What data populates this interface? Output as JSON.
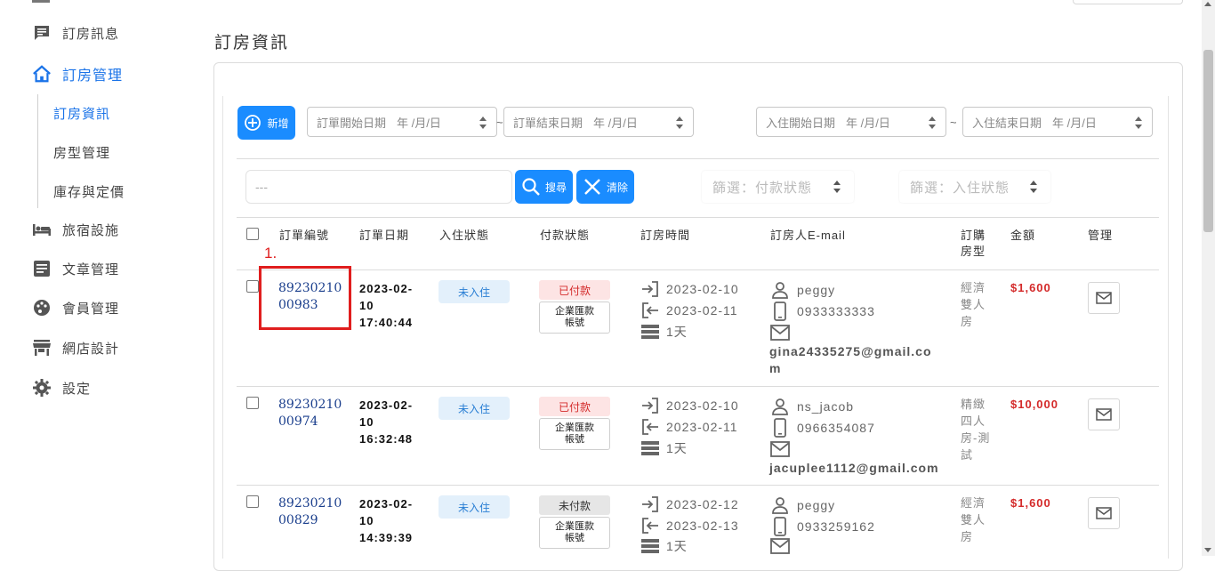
{
  "sidebar": {
    "items": [
      {
        "label": "訂房訊息",
        "icon": "message-icon"
      },
      {
        "label": "訂房管理",
        "icon": "house-icon"
      },
      {
        "label": "旅宿設施",
        "icon": "bed-icon"
      },
      {
        "label": "文章管理",
        "icon": "article-icon"
      },
      {
        "label": "會員管理",
        "icon": "palette-icon"
      },
      {
        "label": "網店設計",
        "icon": "store-icon"
      },
      {
        "label": "設定",
        "icon": "gear-icon"
      }
    ],
    "sub_items": [
      {
        "label": "訂房資訊"
      },
      {
        "label": "房型管理"
      },
      {
        "label": "庫存與定價"
      }
    ]
  },
  "page_title": "訂房資訊",
  "toolbar": {
    "add_label": "新增",
    "order_start": {
      "label": "訂單開始日期",
      "placeholder": "年 /月/日"
    },
    "order_end": {
      "label": "訂單結束日期",
      "placeholder": "年 /月/日"
    },
    "checkin_start": {
      "label": "入住開始日期",
      "placeholder": "年 /月/日"
    },
    "checkin_end": {
      "label": "入住結束日期",
      "placeholder": "年 /月/日"
    },
    "tilde": "~",
    "search_placeholder": "---",
    "search_label": "搜尋",
    "clear_label": "清除",
    "filter_payment": "篩選：付款狀態",
    "filter_stay": "篩選：入住狀態"
  },
  "table": {
    "headers": {
      "order_no": "訂單編號",
      "order_date": "訂單日期",
      "stay_status": "入住狀態",
      "pay_status": "付款狀態",
      "booking_time": "訂房時間",
      "guest_email": "訂房人E-mail",
      "room_type_l1": "訂購",
      "room_type_l2": "房型",
      "amount": "金額",
      "manage": "管理"
    },
    "rows": [
      {
        "order_no_l1": "89230210",
        "order_no_l2": "00983",
        "date_l1": "2023-02-",
        "date_l2": "10",
        "date_l3": "17:40:44",
        "stay": "未入住",
        "pay": "已付款",
        "method_l1": "企業匯款",
        "method_l2": "帳號",
        "checkin": "2023-02-10",
        "checkout": "2023-02-11",
        "nights": "1天",
        "name": "peggy",
        "phone": "0933333333",
        "email_l1": "gina24335275@gmail.co",
        "email_l2": "m",
        "room_l1": "經濟",
        "room_l2": "雙人",
        "room_l3": "房",
        "room_l4": "",
        "amount": "$1,600"
      },
      {
        "order_no_l1": "89230210",
        "order_no_l2": "00974",
        "date_l1": "2023-02-",
        "date_l2": "10",
        "date_l3": "16:32:48",
        "stay": "未入住",
        "pay": "已付款",
        "method_l1": "企業匯款",
        "method_l2": "帳號",
        "checkin": "2023-02-10",
        "checkout": "2023-02-11",
        "nights": "1天",
        "name": "ns_jacob",
        "phone": "0966354087",
        "email_l1": "jacuplee1112@gmail.com",
        "email_l2": "",
        "room_l1": "精緻",
        "room_l2": "四人",
        "room_l3": "房-測",
        "room_l4": "試",
        "amount": "$10,000"
      },
      {
        "order_no_l1": "89230210",
        "order_no_l2": "00829",
        "date_l1": "2023-02-",
        "date_l2": "10",
        "date_l3": "14:39:39",
        "stay": "未入住",
        "pay": "未付款",
        "method_l1": "企業匯款",
        "method_l2": "帳號",
        "checkin": "2023-02-12",
        "checkout": "2023-02-13",
        "nights": "1天",
        "name": "peggy",
        "phone": "0933259162",
        "email_l1": "",
        "email_l2": "",
        "room_l1": "經濟",
        "room_l2": "雙人",
        "room_l3": "房",
        "room_l4": "",
        "amount": "$1,600"
      }
    ]
  },
  "annotation": {
    "label": "1."
  },
  "colors": {
    "accent": "#1a8cff",
    "active_nav": "#1a73e8",
    "amount": "#d42a2a",
    "highlight": "#e01e1e"
  }
}
